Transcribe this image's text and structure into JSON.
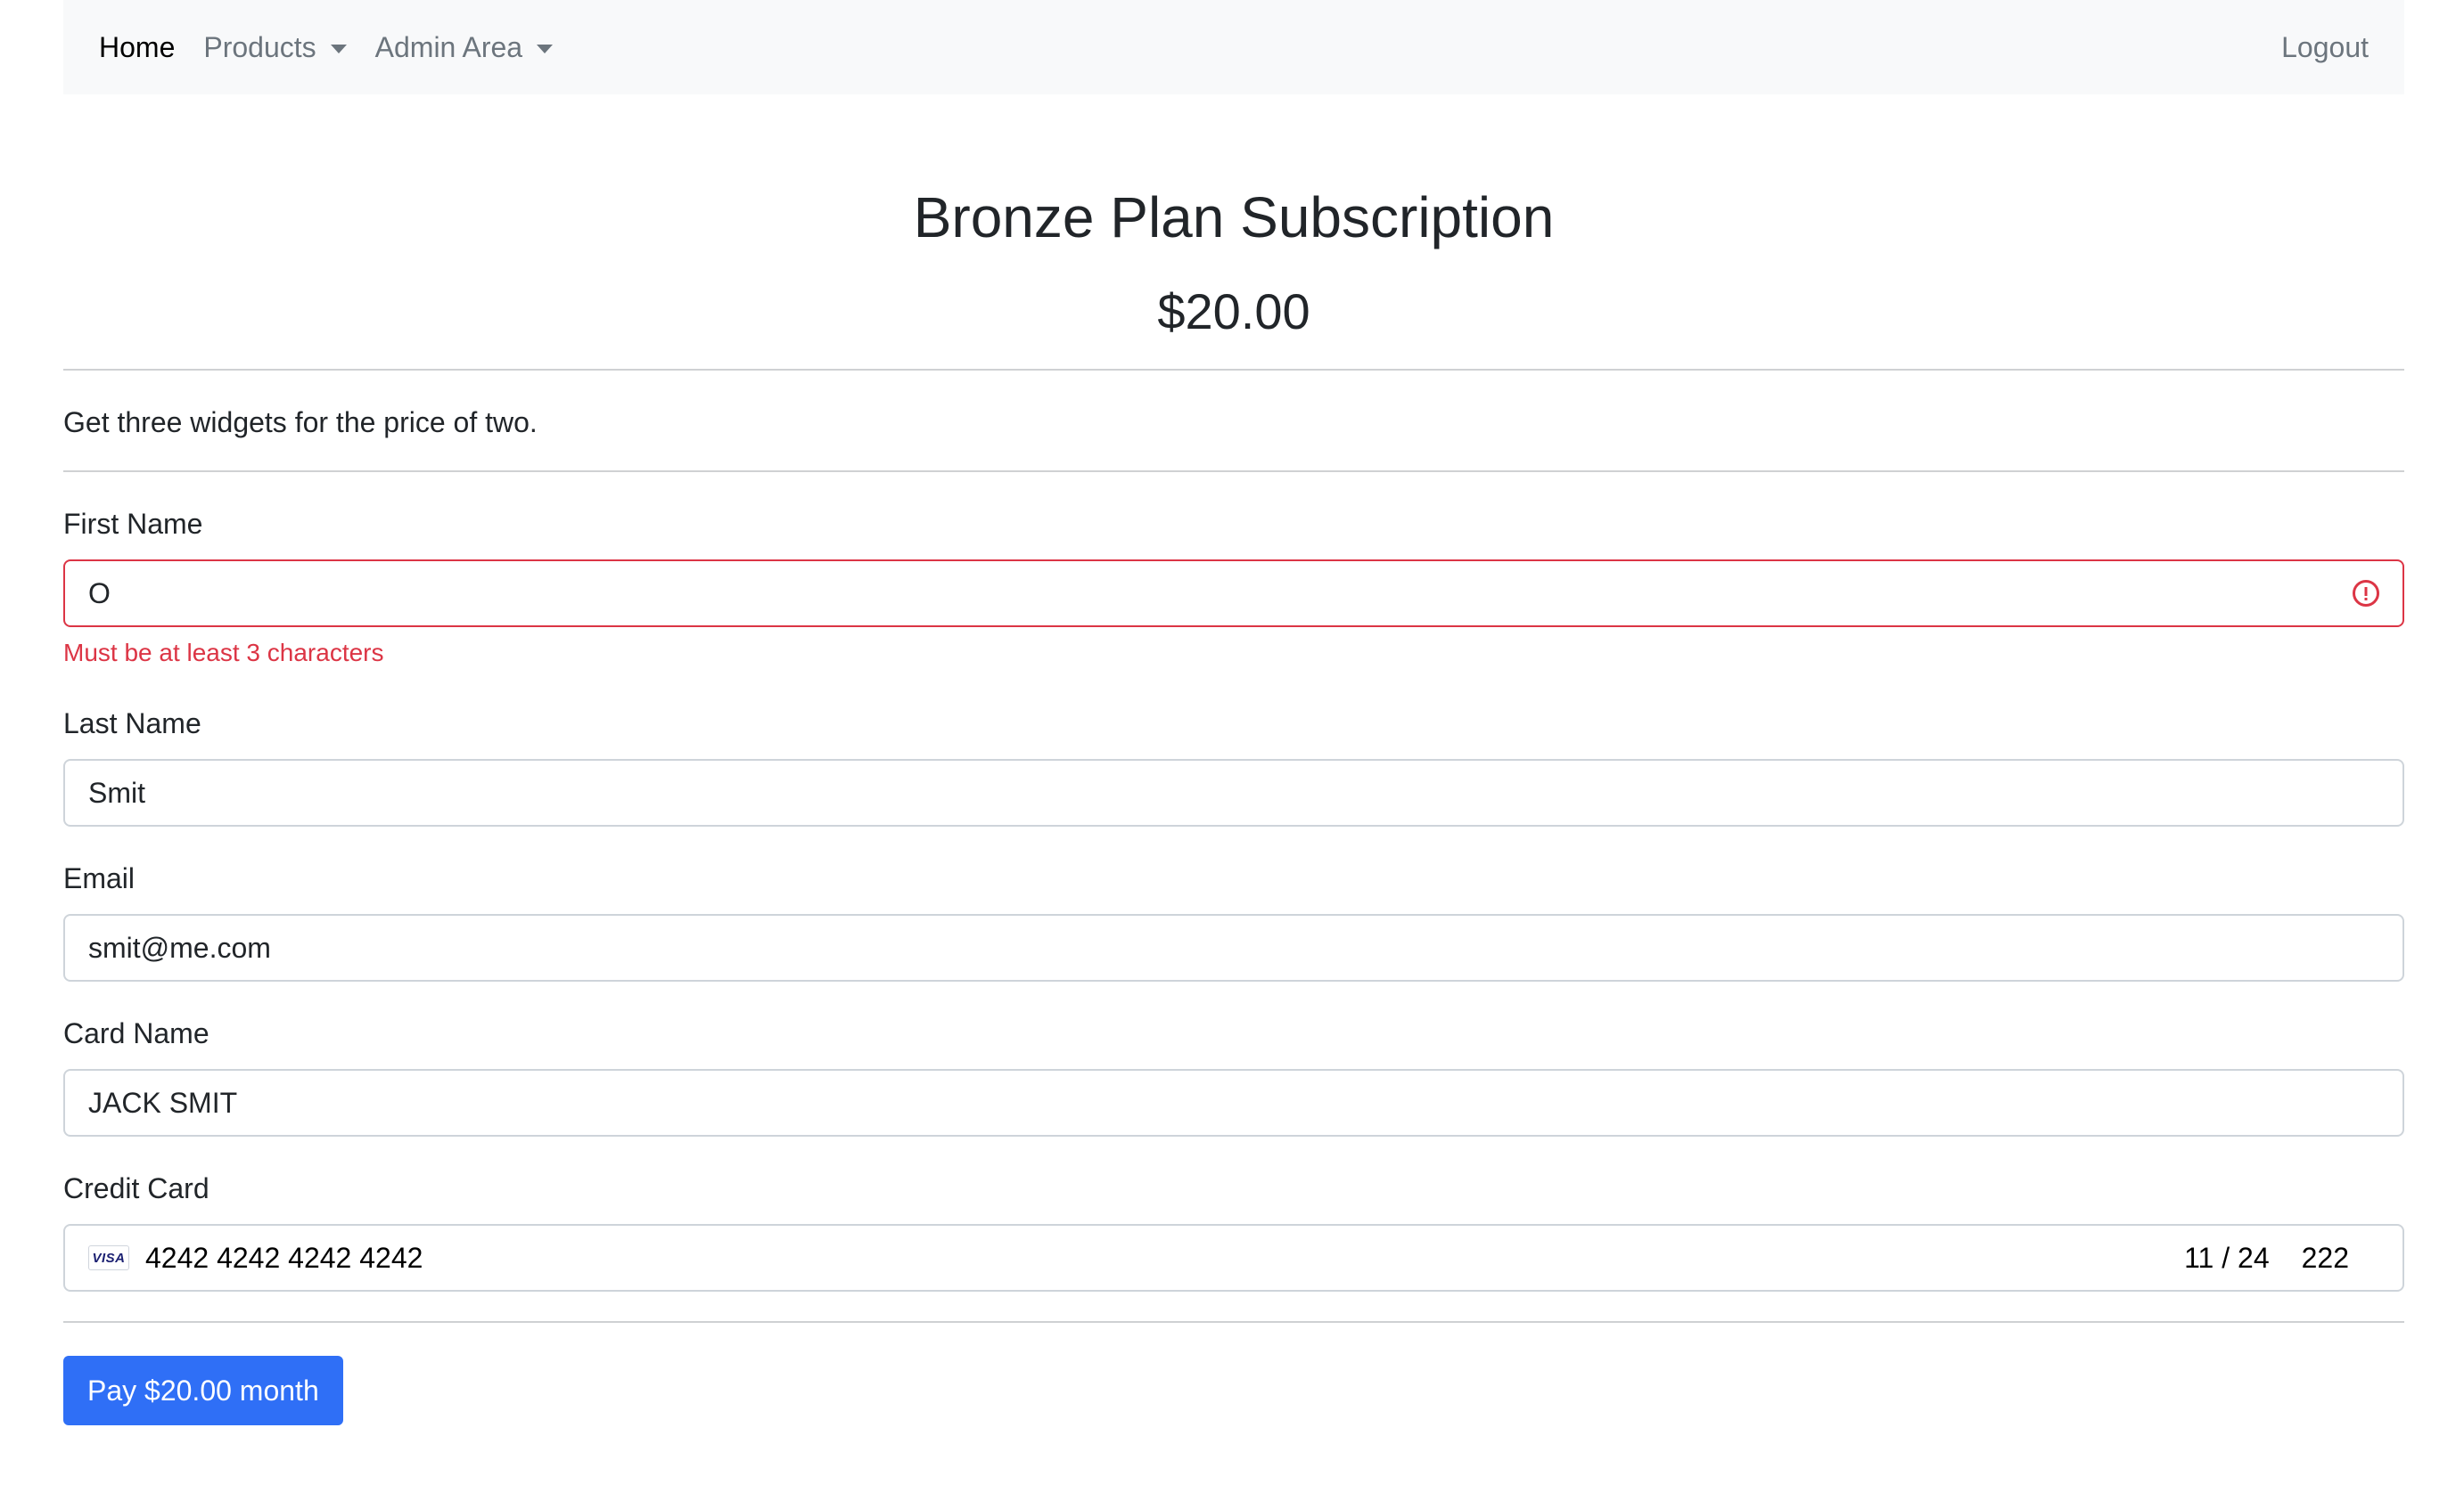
{
  "navbar": {
    "items": [
      {
        "label": "Home"
      },
      {
        "label": "Products"
      },
      {
        "label": "Admin Area"
      }
    ],
    "logout_label": "Logout"
  },
  "product": {
    "title": "Bronze Plan Subscription",
    "price": "$20.00",
    "description": "Get three widgets for the price of two."
  },
  "form": {
    "first_name": {
      "label": "First Name",
      "value": "O",
      "error": "Must be at least 3 characters"
    },
    "last_name": {
      "label": "Last Name",
      "value": "Smit"
    },
    "email": {
      "label": "Email",
      "value": "smit@me.com"
    },
    "card_name": {
      "label": "Card Name",
      "value": "JACK SMIT"
    },
    "credit_card": {
      "label": "Credit Card",
      "brand": "VISA",
      "number": "4242 4242 4242 4242",
      "expiry": "11 / 24",
      "cvc": "222"
    },
    "submit_label": "Pay $20.00 month"
  },
  "colors": {
    "primary": "#2f6ff6",
    "danger": "#dc3545",
    "navbar_bg": "#f8f9fa"
  }
}
